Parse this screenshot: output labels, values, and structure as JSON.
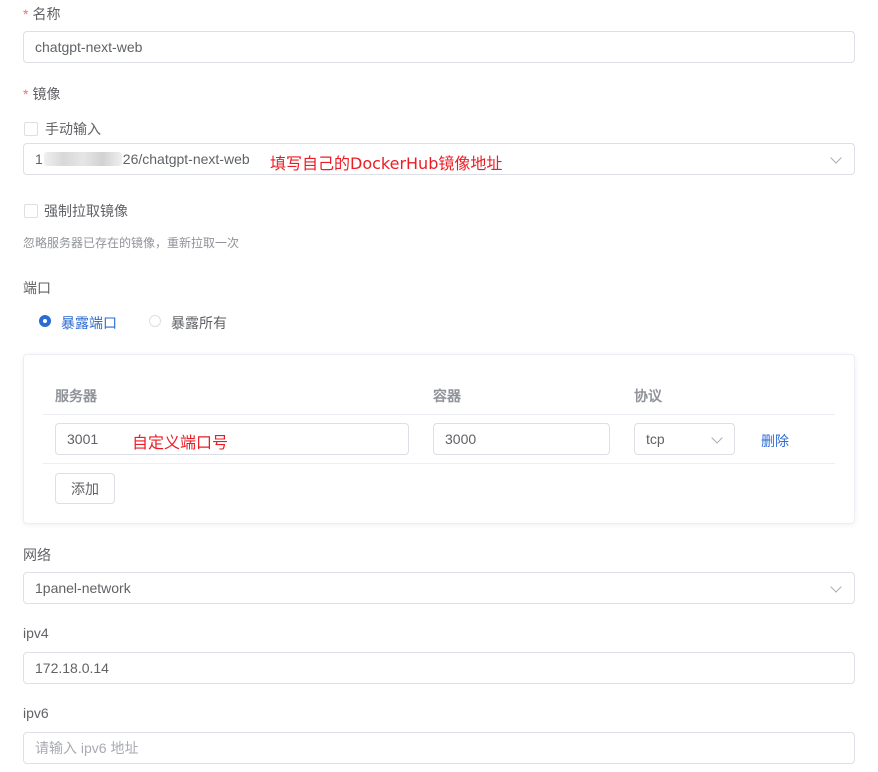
{
  "form": {
    "name": {
      "label": "名称",
      "required": "*",
      "value": "chatgpt-next-web"
    },
    "image": {
      "label": "镜像",
      "required": "*",
      "manual_input_label": "手动输入",
      "value_prefix": "1",
      "value_suffix": "26/chatgpt-next-web",
      "annotation": "填写自己的DockerHub镜像地址"
    },
    "force_pull": {
      "label": "强制拉取镜像",
      "hint": "忽略服务器已存在的镜像，重新拉取一次"
    },
    "ports": {
      "label": "端口",
      "options": [
        "暴露端口",
        "暴露所有"
      ],
      "selected": "暴露端口",
      "table": {
        "headers": {
          "server": "服务器",
          "container": "容器",
          "protocol": "协议"
        },
        "rows": [
          {
            "server": "3001",
            "container": "3000",
            "protocol": "tcp",
            "delete": "删除"
          }
        ],
        "annotation": "自定义端口号",
        "add_label": "添加"
      }
    },
    "network": {
      "label": "网络",
      "value": "1panel-network"
    },
    "ipv4": {
      "label": "ipv4",
      "value": "172.18.0.14"
    },
    "ipv6": {
      "label": "ipv6",
      "placeholder": "请输入 ipv6 地址"
    }
  },
  "colors": {
    "accent": "#2b6bd4",
    "required": "#f56c6c",
    "annotation": "#ec1c24"
  }
}
